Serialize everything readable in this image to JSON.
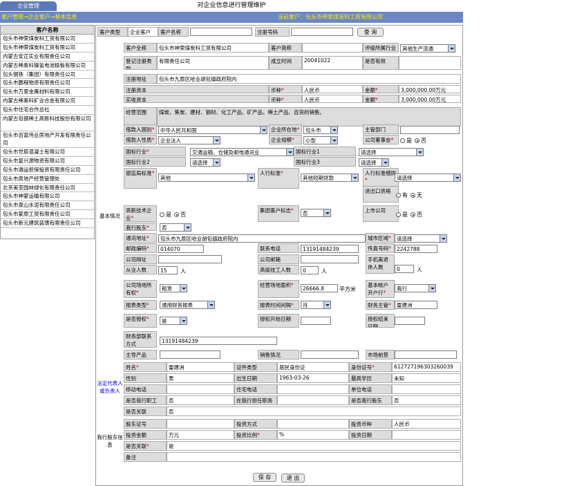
{
  "tab_label": "企业管理",
  "window_title": "对企业信息进行管理维护",
  "breadcrumb": "客户管理→企业客户→基本信息",
  "current_customer": "当前客户：包头市神荣煤炭科工贸有限公司",
  "sidebar": {
    "header": "客户名称",
    "items": [
      "包头市神荣煤炭科工贸有限公司",
      "包头市神荣煤炭科工贸有限公司",
      "内蒙古安正实业有限责任公司",
      "内蒙古稀奥科镍氢电池极板有限公司",
      "包头钢铁（集团）有限责任公司",
      "包头市鹏程物资有限责任公司",
      "包头市万里金属材料有限公司",
      "内蒙古稀奥科矿业合金有限公司",
      "包头市住宅合作总社",
      "内蒙古包钢稀土高新科技股份有限公司",
      "包头市百富伟业房地产开发有限责任公司",
      "包头市世辰混凝土有限公司",
      "包头市复兴源物资有限公司",
      "包头市通运担保投资有限责任公司",
      "包头市房地产经营管理处",
      "北京美亚园林绿化有限责任公司",
      "包头市神蒙运输有限公司",
      "包头市泉山水泥有限责任公司",
      "包头市蒙原工贸有限责任公司",
      "包头市新元建筑装璜有限责任公司"
    ]
  },
  "search": {
    "type_label": "客户类型",
    "type_value": "企业客户",
    "name_label": "客户名称",
    "reg_label": "注册号码",
    "query_btn": "查  询"
  },
  "section_basic": "基本情况",
  "basic": {
    "name_l": "客户全称",
    "name_v": "包头市神荣煤炭科工贸有限公司",
    "short_l": "客户简称",
    "ind_l": "评级所属行业",
    "ind_v": "其他生产流通",
    "regtype_l": "登记注册类型",
    "regtype_v": "有限责任公司",
    "date_l": "成立时间",
    "date_v": "20041022",
    "valid_l": "是否有效",
    "addr_l": "注册地址",
    "addr_v": "包头市九原区哈业胡包镇政府院内",
    "regcap_l": "注册资本",
    "cur_l": "币种",
    "cur_v": "人民币",
    "amt_l": "金额",
    "regcap_v": "3,000,000.00万元",
    "paid_l": "实收资本",
    "paid_v": "3,000,000.00万元",
    "scope_l": "经营范围",
    "scope_v": "煤炭、焦炭、建材、钢材、化工产品、矿产品、稀土产品、百货的销售。",
    "country_l": "借款人国别",
    "country_v": "中华人民共和国",
    "loc_l": "企业所在地",
    "loc_v": "包头市",
    "dept_l": "主管部门",
    "nature_l": "借款人性质",
    "nature_v": "企业法人",
    "scale_l": "企业规模",
    "scale_v": "小型",
    "board_l": "公司董事会",
    "yes": "是",
    "no": "否",
    "nind_l": "国标行业",
    "nind_v": "交通运输、仓储及邮电通讯业",
    "nind1_l": "国标行业1",
    "please": "请选择",
    "nind2_l": "国标行业2",
    "nind3_l": "国标行业3",
    "cbrc_l": "银监局标准",
    "cbrc_v": "其他",
    "bank_l": "人行标准",
    "bank_v": "其他短期贷款",
    "bankd_l": "人行标准细则",
    "imp_l": "进出口资格",
    "have": "有",
    "none": "无",
    "hitech_l": "高新技术企业",
    "group_l": "集团客户标志",
    "group_v": "否",
    "listed_l": "上市公司",
    "share_l": "我行股东",
    "share_v": "否",
    "mail_l": "通讯地址",
    "mail_v": "包头市九原区哈业胡包镇政府院内",
    "city_l": "城市区域",
    "zip_l": "邮政编码",
    "zip_v": "014070",
    "tel_l": "联系电话",
    "tel_v": "13191484239",
    "fax_l": "传真号码",
    "fax_v": "2242788",
    "web_l": "公司网址",
    "email_l": "公司邮箱",
    "retire_l": "手机离退休人数",
    "retire_v": "0",
    "unit": "人",
    "emp_l": "从业人数",
    "emp_v": "15",
    "tech_l": "高级技工人数",
    "tech_v": "0",
    "own_l": "公司场地所有权",
    "own_v": "租赁",
    "area_l": "经营场地面积",
    "area_v": "26666.8",
    "area_u": "平方米",
    "acct_l": "基本帐户开户行",
    "acct_v": "我行",
    "rep_l": "报表类型",
    "rep_v": "通用财务报表",
    "period_l": "报表时间间隔",
    "period_v": "月",
    "fin_l": "财务主管",
    "fin_v": "雷建洲",
    "auth_l": "是否授权",
    "auth_v": "是",
    "astart_l": "授权开始日期",
    "aend_l": "授权结束日期",
    "fincon_l": "财务部联系方式",
    "fincon_v": "13191484239",
    "prod_l": "主导产品",
    "sales_l": "销售情况",
    "mkt_l": "市场前景"
  },
  "section_legal": "法定代表人或负责人",
  "legal": {
    "name_l": "姓名",
    "name_v": "雷建洲",
    "idt_l": "证件类型",
    "idt_v": "居民身份证",
    "idn_l": "身份证号",
    "idn_v": "612727196303260039",
    "sex_l": "性别",
    "sex_v": "男",
    "birth_l": "出生日期",
    "birth_v": "1963-03-26",
    "edu_l": "最高学历",
    "edu_v": "未知",
    "mob_l": "移动电话",
    "home_l": "住宅电话",
    "work_l": "单位电话",
    "emp_l": "是否我行职工",
    "emp_v": "否",
    "duty_l": "在我行担任职务",
    "share_l": "是否我行股东",
    "share_v": "否",
    "rel_l": "是否关联",
    "rel_v": "否"
  },
  "section_share": "我行股东信息",
  "share": {
    "cert_l": "股东证号",
    "way_l": "投资方式",
    "cur_l": "投资币种",
    "cur_v": "人民币",
    "amt_l": "投资金额",
    "amt_v": "万元",
    "ratio_l": "投资比例",
    "ratio_v": "%",
    "date_l": "投资日期",
    "rel_l": "是否关联",
    "rel_v": "是",
    "note_l": "备注"
  },
  "buttons": {
    "save": "保 存",
    "exit": "退 出"
  }
}
